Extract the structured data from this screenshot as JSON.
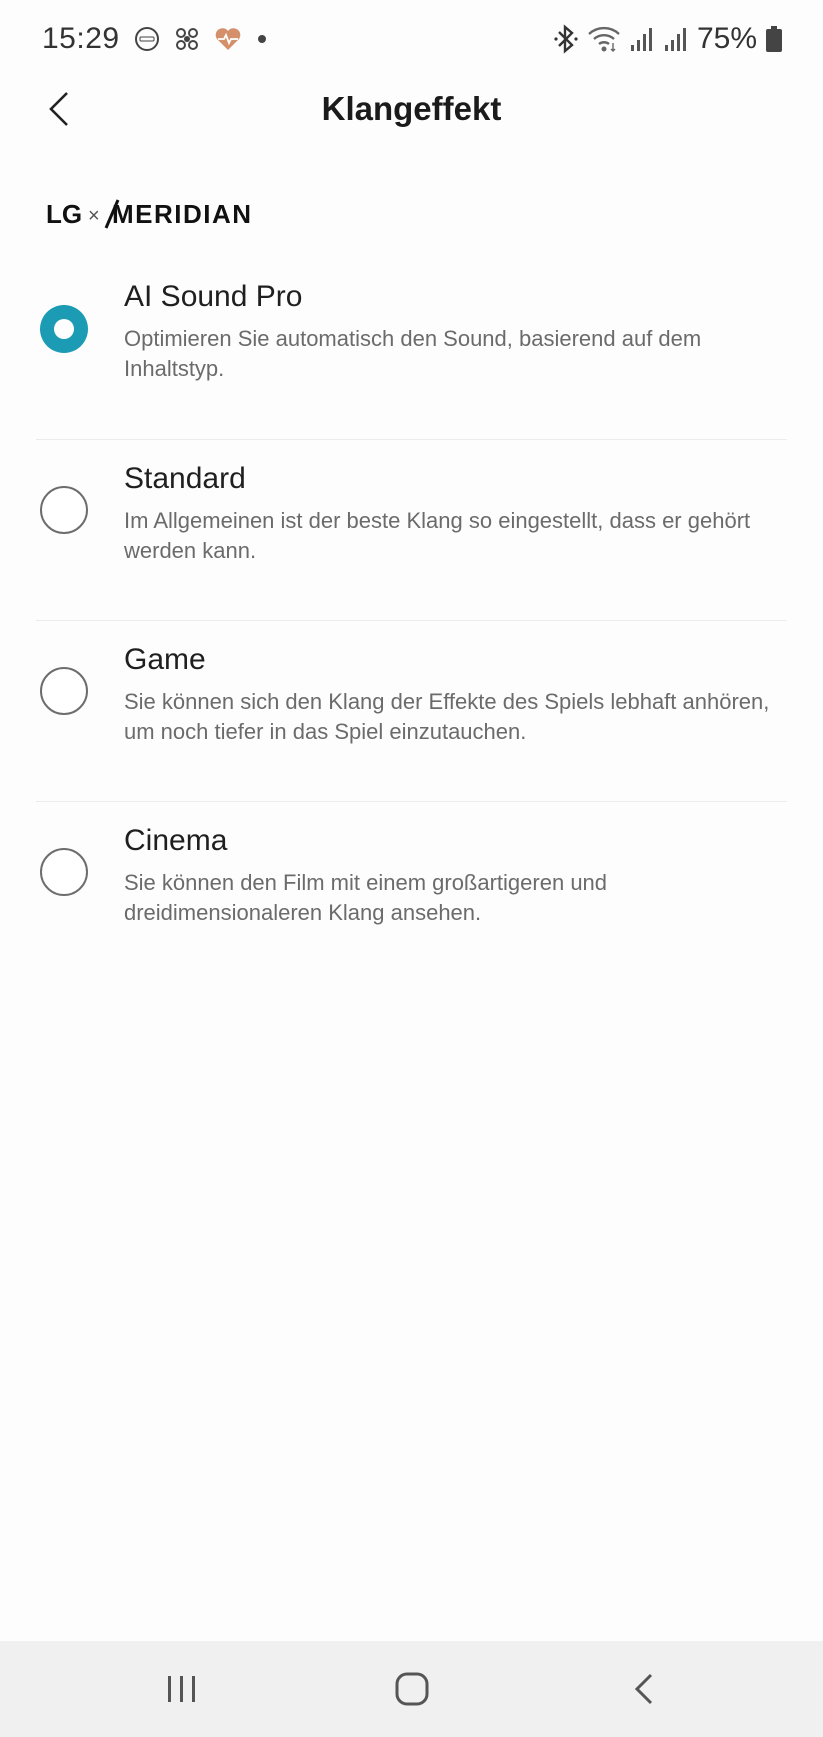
{
  "status_bar": {
    "time": "15:29",
    "battery_percent": "75%",
    "left_icons": [
      "scan-icon",
      "fan-icon",
      "heart-rate-icon",
      "dot-icon"
    ],
    "right_icons": [
      "bluetooth-icon",
      "wifi-icon",
      "signal-icon",
      "signal-icon",
      "battery-icon"
    ]
  },
  "header": {
    "title": "Klangeffekt"
  },
  "brand": {
    "lg": "LG",
    "x": "×",
    "meridian": "MERIDIAN"
  },
  "options": [
    {
      "title": "AI Sound Pro",
      "description": "Optimieren Sie automatisch den Sound, basierend auf dem Inhaltstyp.",
      "selected": true
    },
    {
      "title": "Standard",
      "description": "Im Allgemeinen ist der beste Klang so eingestellt, dass er gehört werden kann.",
      "selected": false
    },
    {
      "title": "Game",
      "description": "Sie können sich den Klang der Effekte des Spiels lebhaft anhören, um noch tiefer in das Spiel einzutauchen.",
      "selected": false
    },
    {
      "title": "Cinema",
      "description": "Sie können den Film mit einem großartigeren und dreidimensionaleren Klang ansehen.",
      "selected": false
    }
  ],
  "colors": {
    "accent": "#1b9bb4",
    "nav_bg": "#f0f0f0"
  }
}
